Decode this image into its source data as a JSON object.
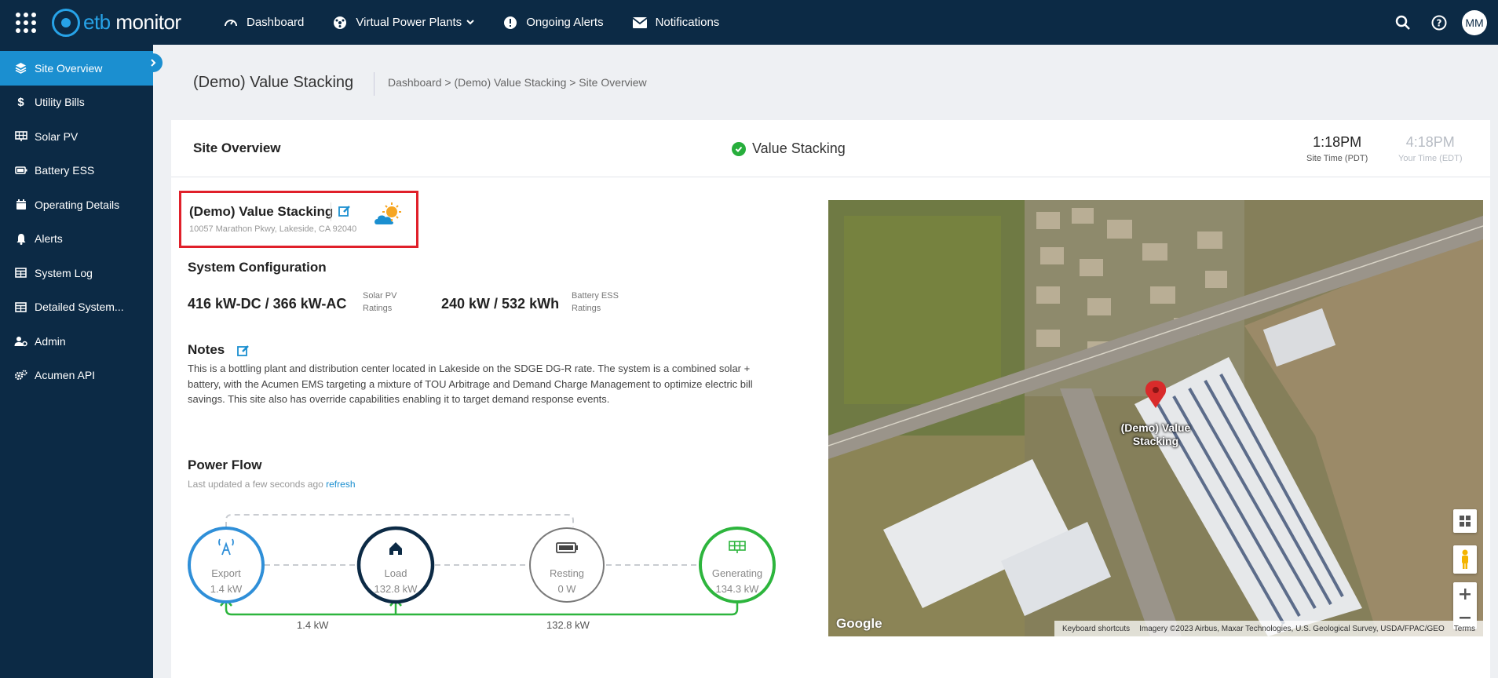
{
  "topbar": {
    "logo_prefix": "etb",
    "logo_suffix": "monitor",
    "nav": [
      {
        "label": "Dashboard",
        "icon": "gauge-icon"
      },
      {
        "label": "Virtual Power Plants",
        "icon": "network-icon"
      },
      {
        "label": "Ongoing Alerts",
        "icon": "exclamation-icon"
      },
      {
        "label": "Notifications",
        "icon": "envelope-icon"
      }
    ],
    "avatar_initials": "MM"
  },
  "sidebar": {
    "items": [
      {
        "label": "Site Overview",
        "icon": "layers-icon",
        "active": true
      },
      {
        "label": "Utility Bills",
        "icon": "dollar-icon"
      },
      {
        "label": "Solar PV",
        "icon": "solar-panel-icon"
      },
      {
        "label": "Battery ESS",
        "icon": "battery-icon"
      },
      {
        "label": "Operating Details",
        "icon": "calendar-icon"
      },
      {
        "label": "Alerts",
        "icon": "bell-icon"
      },
      {
        "label": "System Log",
        "icon": "table-icon"
      },
      {
        "label": "Detailed System...",
        "icon": "table-icon"
      },
      {
        "label": "Admin",
        "icon": "user-gear-icon"
      },
      {
        "label": "Acumen API",
        "icon": "gears-icon"
      }
    ]
  },
  "header": {
    "title": "(Demo) Value Stacking",
    "breadcrumb": "Dashboard > (Demo) Value Stacking > Site Overview"
  },
  "card": {
    "title": "Site Overview",
    "status": "Value Stacking",
    "site_time": "1:18PM",
    "site_time_label": "Site Time (PDT)",
    "your_time": "4:18PM",
    "your_time_label": "Your Time (EDT)"
  },
  "site": {
    "name": "(Demo) Value Stacking",
    "address": "10057 Marathon Pkwy, Lakeside, CA 92040"
  },
  "system_config": {
    "title": "System Configuration",
    "solar_value": "416 kW-DC / 366 kW-AC",
    "solar_label_1": "Solar PV",
    "solar_label_2": "Ratings",
    "battery_value": "240 kW / 532 kWh",
    "battery_label_1": "Battery ESS",
    "battery_label_2": "Ratings"
  },
  "notes": {
    "title": "Notes",
    "text": "This is a bottling plant and distribution center located in Lakeside on the SDGE DG-R rate. The system is a combined solar + battery, with the Acumen EMS targeting a mixture of TOU Arbitrage and Demand Charge Management to optimize electric bill savings. This site also has override capabilities enabling it to target demand response events."
  },
  "power_flow": {
    "title": "Power Flow",
    "updated": "Last updated a few seconds ago",
    "refresh": "refresh",
    "nodes": [
      {
        "label": "Export",
        "value": "1.4 kW",
        "color": "#2f8fd8"
      },
      {
        "label": "Load",
        "value": "132.8 kW",
        "color": "#0c2a45"
      },
      {
        "label": "Resting",
        "value": "0 W",
        "color": "#7a7a7a"
      },
      {
        "label": "Generating",
        "value": "134.3 kW",
        "color": "#2db53d"
      }
    ],
    "flow_export": "1.4 kW",
    "flow_load": "132.8 kW"
  },
  "map": {
    "pin_label_1": "(Demo) Value",
    "pin_label_2": "Stacking",
    "google": "Google",
    "attrib_shortcuts": "Keyboard shortcuts",
    "attrib_imagery": "Imagery ©2023 Airbus, Maxar Technologies, U.S. Geological Survey, USDA/FPAC/GEO",
    "attrib_terms": "Terms"
  }
}
